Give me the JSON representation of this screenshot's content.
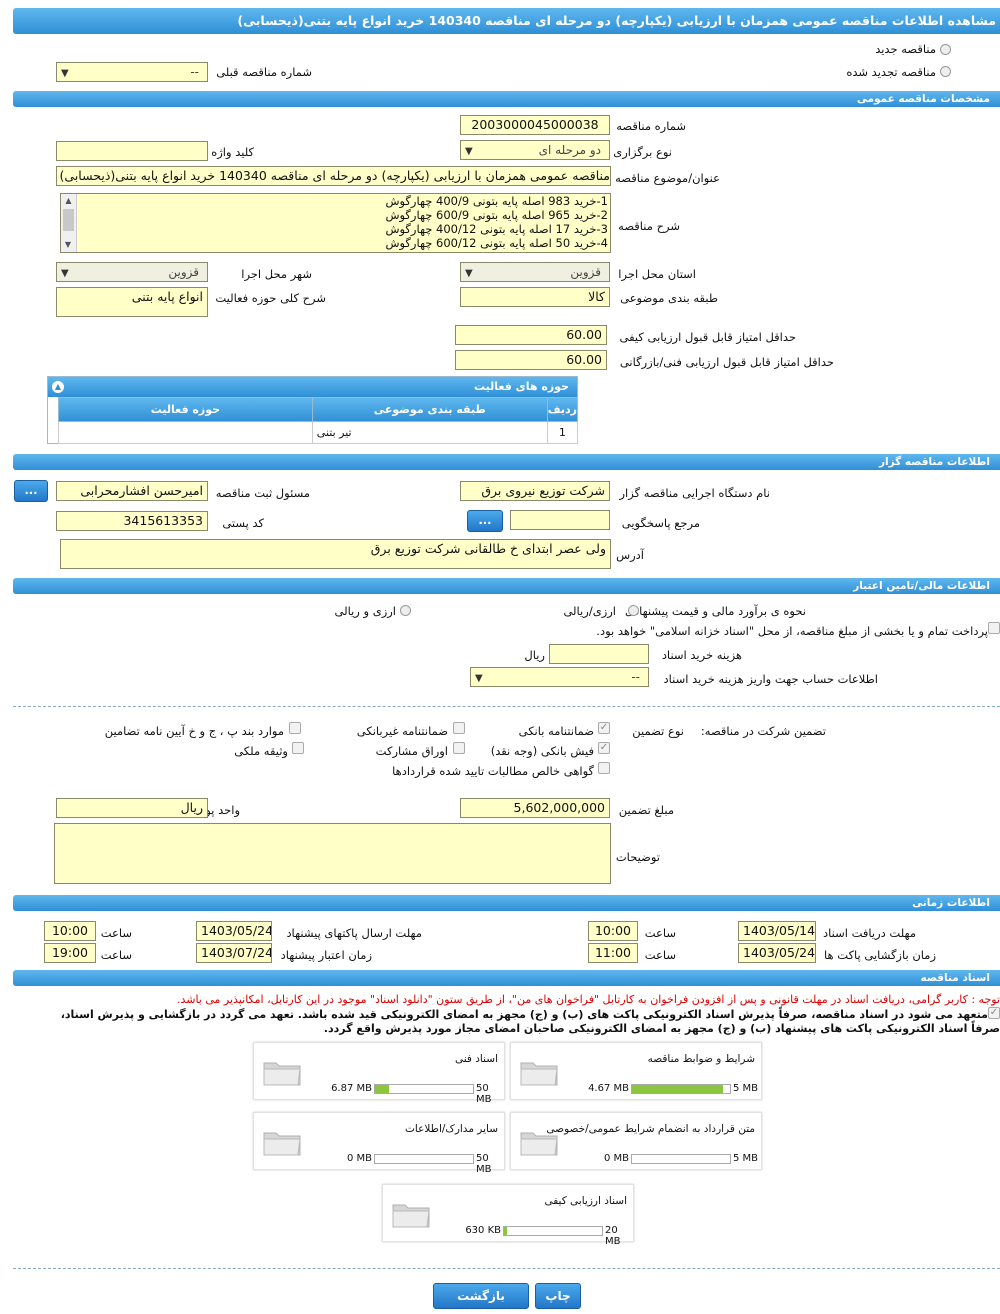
{
  "page_title": "مشاهده اطلاعات مناقصه عمومی همزمان با ارزیابی (یکپارچه) دو مرحله ای مناقصه 140340 خرید انواع پایه بتنی(ذیحسابی)",
  "top": {
    "new_tender": "مناقصه جدید",
    "renewed_tender": "مناقصه تجدید شده",
    "prev_number_label": "شماره مناقصه قبلی",
    "prev_number_value": "--"
  },
  "general": {
    "header": "مشخصات مناقصه عمومی",
    "number_label": "شماره مناقصه",
    "number_value": "2003000045000038",
    "type_label": "نوع برگزاری",
    "type_value": "دو مرحله ای",
    "keyword_label": "کلید واژه",
    "keyword_value": "",
    "subject_label": "عنوان/موضوع مناقصه",
    "subject_value": "مناقصه عمومی همزمان با ارزیابی (یکپارچه) دو مرحله ای مناقصه 140340 خرید انواع پایه بتنی(ذیحسابی)",
    "desc_label": "شرح مناقصه",
    "desc_lines": [
      "1-خرید 983 اصله پایه بتونی 400/9 چهارگوش",
      "2-خرید 965 اصله پایه بتونی 600/9 چهارگوش",
      "3-خرید 17 اصله پایه بتونی 400/12 چهارگوش",
      "4-خرید 50 اصله پایه بتونی 600/12 چهارگوش"
    ],
    "province_label": "استان محل اجرا",
    "province_value": "قزوین",
    "city_label": "شهر محل اجرا",
    "city_value": "قزوین",
    "category_label": "طبقه بندی موضوعی",
    "category_value": "کالا",
    "activity_label": "شرح کلی حوزه فعالیت",
    "activity_value": "انواع پایه بتنی",
    "min_quality_label": "حداقل امتیاز قابل قبول ارزیابی کیفی",
    "min_quality_value": "60.00",
    "min_tech_label": "حداقل امتیاز قابل قبول ارزیابی فنی/بازرگانی",
    "min_tech_value": "60.00"
  },
  "activity_table": {
    "header": "حوزه های فعالیت",
    "columns": [
      "ردیف",
      "طبقه بندی موضوعی",
      "حوزه فعالیت"
    ],
    "rows": [
      [
        "1",
        "تیر بتنی",
        ""
      ]
    ]
  },
  "organizer": {
    "header": "اطلاعات مناقصه گزار",
    "org_label": "نام دستگاه اجرایی مناقصه گزار",
    "org_value": "شرکت توزیع نیروی برق",
    "registrar_label": "مسئول ثبت مناقصه",
    "registrar_value": "امیرحسن افشارمحرابی",
    "ref_label": "مرجع پاسخگویی",
    "ref_value": "",
    "postal_label": "کد پستی",
    "postal_value": "3415613353",
    "address_label": "آدرس",
    "address_value": "ولی عصر ابتدای خ طالقانی شرکت توزیع برق",
    "dots": "..."
  },
  "finance": {
    "header": "اطلاعات مالی/تامین اعتبار",
    "estimate_label": "نحوه ی برآورد مالی و قیمت پیشنهادی",
    "opt_rial": "ارزی/ریالی",
    "opt_both": "ارزی و ریالی",
    "payment_note": "پرداخت تمام و یا بخشی از مبلغ مناقصه، از محل \"اسناد خزانه اسلامی\" خواهد بود.",
    "doc_cost_label": "هزینه خرید اسناد",
    "doc_cost_unit": "ریال",
    "account_label": "اطلاعات حساب جهت واریز هزینه خرید اسناد",
    "account_value": "--"
  },
  "guarantee": {
    "label": "تضمین شرکت در مناقصه:",
    "type_label": "نوع تضمین",
    "options": [
      "ضمانتنامه بانکی",
      "ضمانتنامه غیربانکی",
      "موارد بند پ ، ج و خ آیین نامه تضامین",
      "فیش بانکی (وجه نقد)",
      "اوراق مشارکت",
      "وثیقه ملکی",
      "گواهی خالص مطالبات تایید شده قراردادها"
    ],
    "amount_label": "مبلغ تضمین",
    "amount_value": "5,602,000,000",
    "currency_label": "واحد پول",
    "currency_value": "ریال",
    "notes_label": "توضیحات",
    "notes_value": ""
  },
  "timing": {
    "header": "اطلاعات زمانی",
    "doc_deadline_label": "مهلت دریافت اسناد",
    "doc_deadline_date": "1403/05/14",
    "doc_deadline_time": "10:00",
    "send_deadline_label": "مهلت ارسال پاکتهای پیشنهاد",
    "send_deadline_date": "1403/05/24",
    "send_deadline_time": "10:00",
    "open_label": "زمان بازگشایی پاکت ها",
    "open_date": "1403/05/24",
    "open_time": "11:00",
    "validity_label": "زمان اعتبار پیشنهاد",
    "validity_date": "1403/07/24",
    "validity_time": "19:00",
    "time_label": "ساعت"
  },
  "documents": {
    "header": "اسناد مناقصه",
    "note": "توجه : کاربر گرامی، دریافت اسناد در مهلت قانونی و پس از افزودن فراخوان به کارتابل \"فراخوان های من\"، از طریق ستون \"دانلود اسناد\" موجود در این کارتابل، امکانپذیر می باشد.",
    "commit_line1": "متعهد می شود در اسناد مناقصه، صرفاً پذیرش اسناد الکترونیکی پاکت های (ب) و (ج) مجهز به امضای الکترونیکی قید شده باشد. تعهد می گردد در بازگشایی و پذیرش اسناد،",
    "commit_line2": "صرفاً اسناد الکترونیکی پاکت های پیشنهاد (ب) و (ج) مجهز به امضای الکترونیکی صاحبان امضای مجاز مورد پذیرش واقع گردد.",
    "files": [
      {
        "title": "شرایط و ضوابط مناقصه",
        "used": "4.67 MB",
        "limit": "5 MB",
        "fill": 0.93
      },
      {
        "title": "اسناد فنی",
        "used": "6.87 MB",
        "limit": "50 MB",
        "fill": 0.14
      },
      {
        "title": "متن قرارداد به انضمام شرایط عمومی/خصوصی",
        "used": "0 MB",
        "limit": "5 MB",
        "fill": 0
      },
      {
        "title": "سایر مدارک/اطلاعات",
        "used": "0 MB",
        "limit": "50 MB",
        "fill": 0
      },
      {
        "title": "اسناد ارزیابی کیفی",
        "used": "630 KB",
        "limit": "20 MB",
        "fill": 0.03
      }
    ]
  },
  "buttons": {
    "back": "بازگشت",
    "print": "چاپ"
  },
  "colors": {
    "header": "#3598dc",
    "field": "#ffffc8",
    "progress": "#8cc63f"
  }
}
